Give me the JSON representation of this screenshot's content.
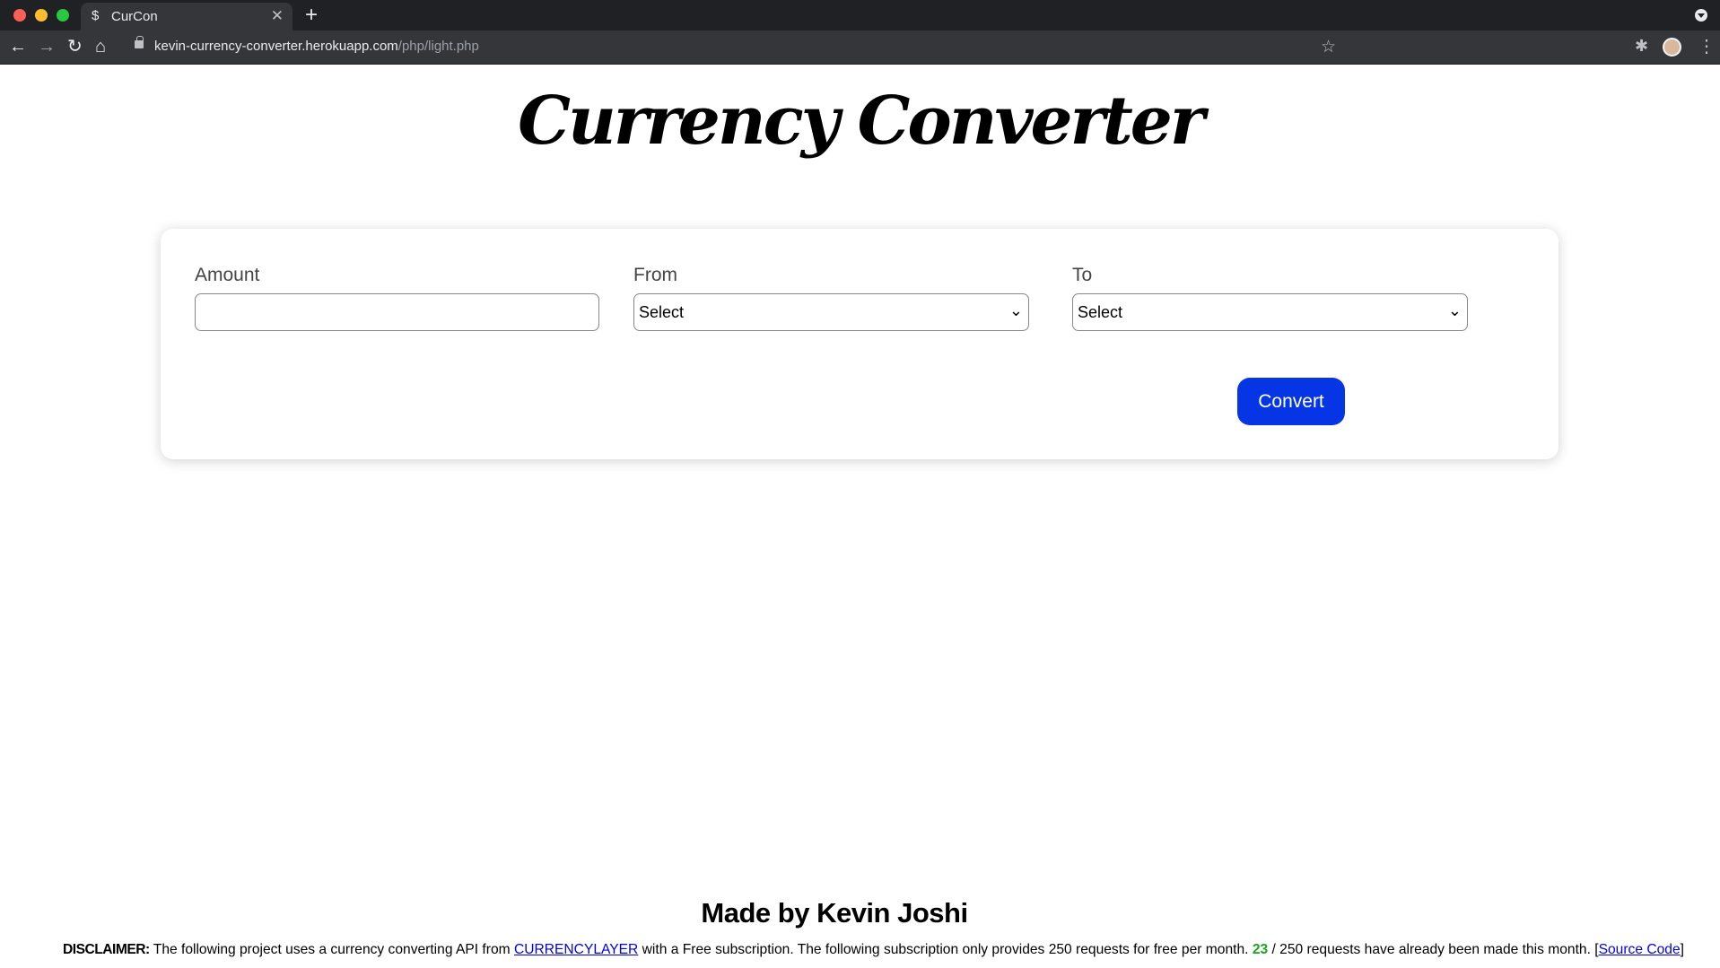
{
  "browser": {
    "tab_title": "CurCon",
    "tab_favicon": "$",
    "url_host": "kevin-currency-converter.herokuapp.com",
    "url_path": "/php/light.php"
  },
  "page": {
    "title": "Currency Converter",
    "form": {
      "amount_label": "Amount",
      "amount_value": "",
      "from_label": "From",
      "from_selected": "Select",
      "to_label": "To",
      "to_selected": "Select",
      "convert_label": "Convert"
    },
    "footer": {
      "made_by": "Made by Kevin Joshi",
      "disclaimer_label": "DISCLAIMER:",
      "disclaimer_text_1": "The following project uses a currency converting API from",
      "api_link": "CURRENCYLAYER",
      "disclaimer_text_2": "with a Free subscription. The following subscription only provides 250 requests for free per month.",
      "requests_used": "23",
      "disclaimer_text_3": "/ 250 requests have already been made this month. [",
      "source_link": "Source Code",
      "disclaimer_text_4": "]"
    }
  },
  "colors": {
    "accent": "#0635e6",
    "count_color": "#1aa51a"
  }
}
